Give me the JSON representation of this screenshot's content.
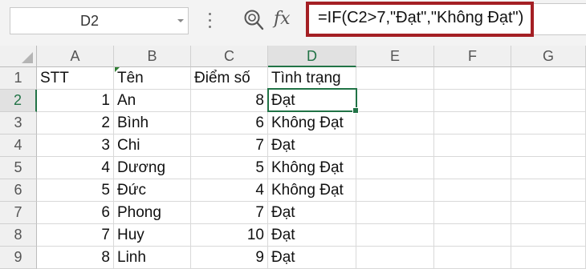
{
  "name_box": {
    "value": "D2"
  },
  "formula_bar": {
    "formula": "=IF(C2>7,\"Đạt\",\"Không Đạt\")"
  },
  "columns": [
    "A",
    "B",
    "C",
    "D",
    "E",
    "F",
    "G"
  ],
  "active_cell": "D2",
  "header_row": {
    "row": "1",
    "cells": [
      "STT",
      "Tên",
      "Điểm số",
      "Tình trạng"
    ]
  },
  "rows": [
    {
      "row": "2",
      "stt": "1",
      "ten": "An",
      "diem": "8",
      "tinh_trang": "Đạt"
    },
    {
      "row": "3",
      "stt": "2",
      "ten": "Bình",
      "diem": "6",
      "tinh_trang": "Không Đạt"
    },
    {
      "row": "4",
      "stt": "3",
      "ten": "Chi",
      "diem": "7",
      "tinh_trang": "Đạt"
    },
    {
      "row": "5",
      "stt": "4",
      "ten": "Dương",
      "diem": "5",
      "tinh_trang": "Không Đạt"
    },
    {
      "row": "6",
      "stt": "5",
      "ten": "Đức",
      "diem": "4",
      "tinh_trang": "Không Đạt"
    },
    {
      "row": "7",
      "stt": "6",
      "ten": "Phong",
      "diem": "7",
      "tinh_trang": "Đạt"
    },
    {
      "row": "8",
      "stt": "7",
      "ten": "Huy",
      "diem": "10",
      "tinh_trang": "Đạt"
    },
    {
      "row": "9",
      "stt": "8",
      "ten": "Linh",
      "diem": "9",
      "tinh_trang": "Đạt"
    }
  ],
  "colors": {
    "highlight_border": "#a41f24",
    "selection": "#217346"
  }
}
